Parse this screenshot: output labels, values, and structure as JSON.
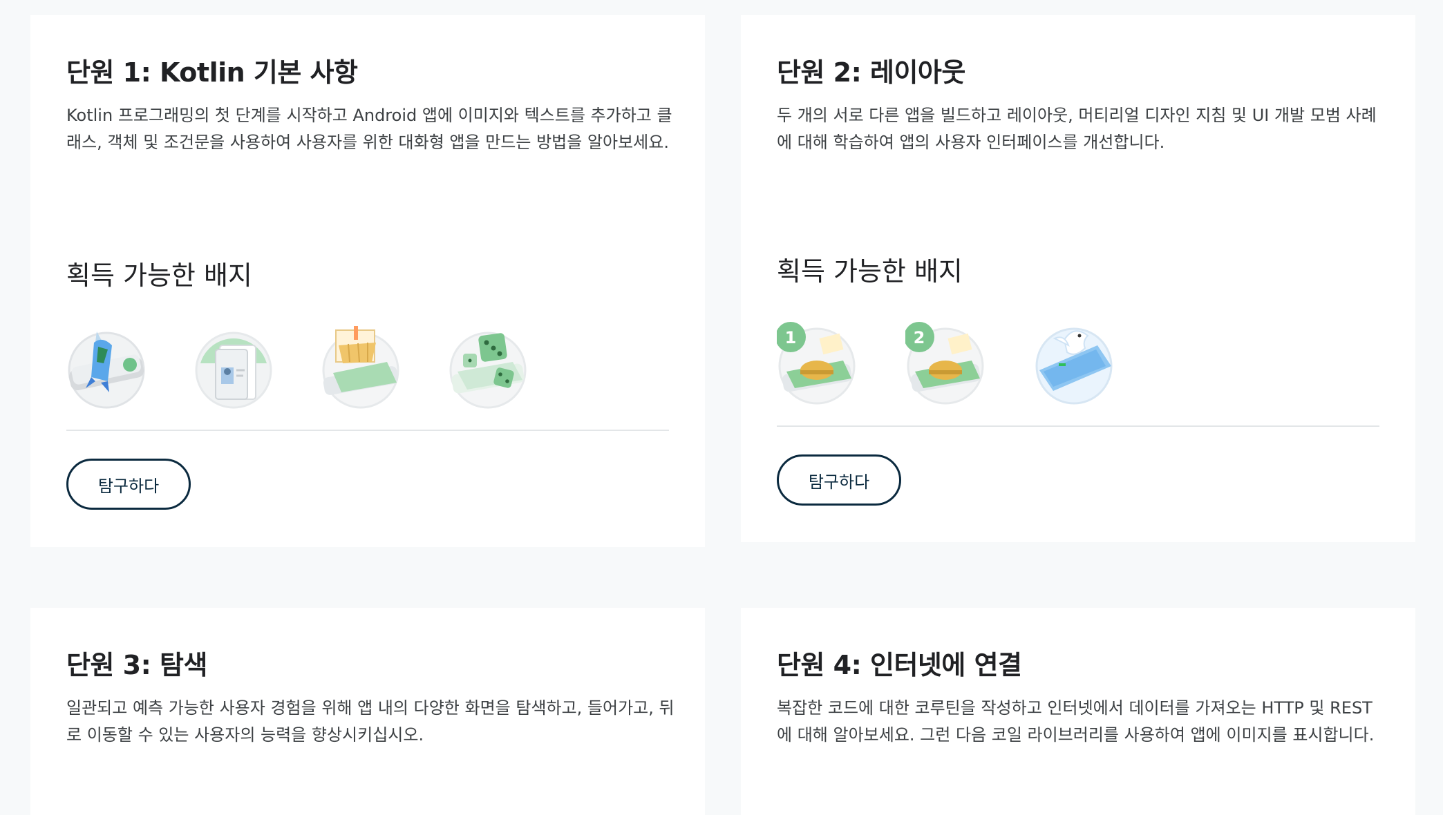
{
  "units": [
    {
      "title": "단원 1: Kotlin 기본 사항",
      "description": "Kotlin 프로그래밍의 첫 단계를 시작하고 Android 앱에 이미지와 텍스트를 추가하고 클래스, 객체 및 조건문을 사용하여 사용자를 위한 대화형 앱을 만드는 방법을 알아보세요.",
      "badges_title": "획득 가능한 배지",
      "badges": [
        "rocket-phone-badge-icon",
        "profile-card-badge-icon",
        "shopping-basket-badge-icon",
        "dice-roll-badge-icon"
      ],
      "button_label": "탐구하다"
    },
    {
      "title": "단원 2: 레이아웃",
      "description": "두 개의 서로 다른 앱을 빌드하고 레이아웃, 머티리얼 디자인 지침 및 UI 개발 모범 사례에 대해 학습하여 앱의 사용자 인터페이스를 개선합니다.",
      "badges_title": "획득 가능한 배지",
      "badges": [
        "tip-calculator-badge-1-icon",
        "tip-calculator-badge-2-icon",
        "bird-badge-icon"
      ],
      "badge_numbers": [
        "1",
        "2"
      ],
      "button_label": "탐구하다"
    },
    {
      "title": "단원 3: 탐색",
      "description": "일관되고 예측 가능한 사용자 경험을 위해 앱 내의 다양한 화면을 탐색하고, 들어가고, 뒤로 이동할 수 있는 사용자의 능력을 향상시키십시오."
    },
    {
      "title": "단원 4: 인터넷에 연결",
      "description": "복잡한 코드에 대한 코루틴을 작성하고 인터넷에서 데이터를 가져오는 HTTP 및 REST에 대해 알아보세요. 그런 다음 코일 라이브러리를 사용하여 앱에 이미지를 표시합니다."
    }
  ],
  "colors": {
    "page_bg": "#f7f9fa",
    "card_bg": "#ffffff",
    "button_border": "#0b2a3f",
    "badge_green": "#7dc68f",
    "badge_blue": "#8ec6f2"
  }
}
